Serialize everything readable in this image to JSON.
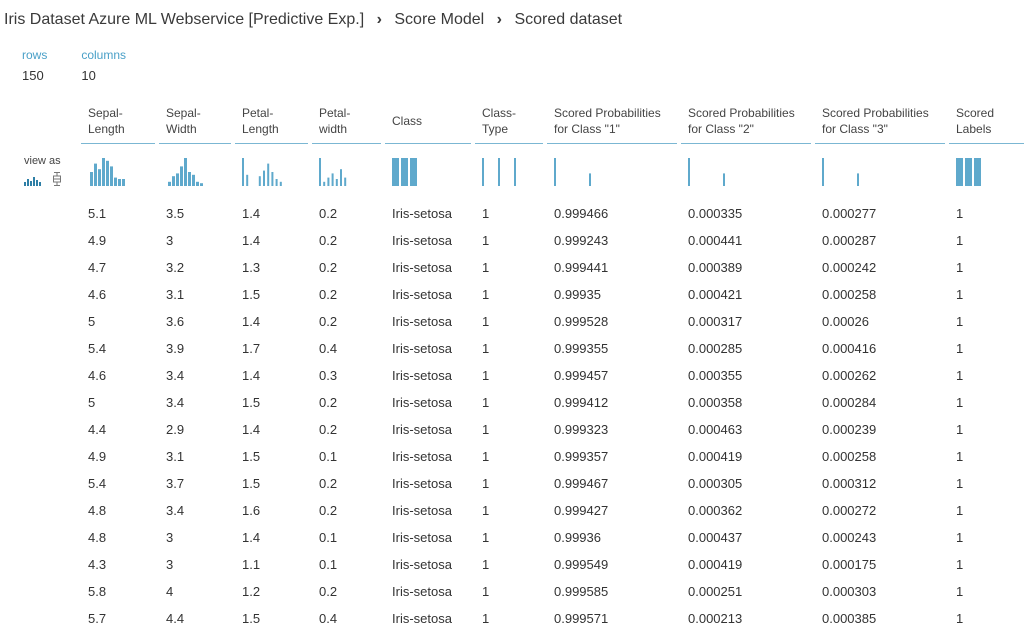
{
  "breadcrumb": {
    "experiment": "Iris Dataset Azure ML Webservice [Predictive Exp.]",
    "module": "Score Model",
    "port": "Scored dataset"
  },
  "stats": {
    "rows_label": "rows",
    "rows_value": "150",
    "columns_label": "columns",
    "columns_value": "10"
  },
  "view_as": {
    "label": "view as",
    "icons": [
      "histogram-icon",
      "boxplot-icon"
    ]
  },
  "columns": [
    "Sepal-\nLength",
    "Sepal-\nWidth",
    "Petal-\nLength",
    "Petal-\nwidth",
    "Class",
    "Class-\nType",
    "Scored Probabilities\nfor Class \"1\"",
    "Scored Probabilities\nfor Class \"2\"",
    "Scored Probabilities\nfor Class \"3\"",
    "Scored\nLabels"
  ],
  "histograms": [
    {
      "type": "dense",
      "bars": [
        0.5,
        0.8,
        0.6,
        1.0,
        0.9,
        0.7,
        0.3,
        0.25,
        0.25
      ]
    },
    {
      "type": "dense",
      "bars": [
        0.15,
        0.35,
        0.45,
        0.7,
        1.0,
        0.5,
        0.4,
        0.15,
        0.1
      ]
    },
    {
      "type": "sparse",
      "bars": [
        1.0,
        0.4,
        0,
        0,
        0.35,
        0.55,
        0.8,
        0.5,
        0.25,
        0.15
      ]
    },
    {
      "type": "sparse",
      "bars": [
        1.0,
        0.15,
        0.3,
        0.45,
        0.25,
        0.6,
        0.3
      ]
    },
    {
      "type": "blocks",
      "bars": [
        1.0,
        1.0,
        1.0
      ]
    },
    {
      "type": "lines",
      "bars": [
        1.0,
        1.0,
        1.0
      ]
    },
    {
      "type": "two",
      "bars": [
        1.0,
        0.45
      ]
    },
    {
      "type": "two",
      "bars": [
        1.0,
        0.45
      ]
    },
    {
      "type": "two",
      "bars": [
        1.0,
        0.45
      ]
    },
    {
      "type": "blocks",
      "bars": [
        1.0,
        1.0,
        1.0
      ]
    }
  ],
  "rows": [
    [
      "5.1",
      "3.5",
      "1.4",
      "0.2",
      "Iris-setosa",
      "1",
      "0.999466",
      "0.000335",
      "0.000277",
      "1"
    ],
    [
      "4.9",
      "3",
      "1.4",
      "0.2",
      "Iris-setosa",
      "1",
      "0.999243",
      "0.000441",
      "0.000287",
      "1"
    ],
    [
      "4.7",
      "3.2",
      "1.3",
      "0.2",
      "Iris-setosa",
      "1",
      "0.999441",
      "0.000389",
      "0.000242",
      "1"
    ],
    [
      "4.6",
      "3.1",
      "1.5",
      "0.2",
      "Iris-setosa",
      "1",
      "0.99935",
      "0.000421",
      "0.000258",
      "1"
    ],
    [
      "5",
      "3.6",
      "1.4",
      "0.2",
      "Iris-setosa",
      "1",
      "0.999528",
      "0.000317",
      "0.00026",
      "1"
    ],
    [
      "5.4",
      "3.9",
      "1.7",
      "0.4",
      "Iris-setosa",
      "1",
      "0.999355",
      "0.000285",
      "0.000416",
      "1"
    ],
    [
      "4.6",
      "3.4",
      "1.4",
      "0.3",
      "Iris-setosa",
      "1",
      "0.999457",
      "0.000355",
      "0.000262",
      "1"
    ],
    [
      "5",
      "3.4",
      "1.5",
      "0.2",
      "Iris-setosa",
      "1",
      "0.999412",
      "0.000358",
      "0.000284",
      "1"
    ],
    [
      "4.4",
      "2.9",
      "1.4",
      "0.2",
      "Iris-setosa",
      "1",
      "0.999323",
      "0.000463",
      "0.000239",
      "1"
    ],
    [
      "4.9",
      "3.1",
      "1.5",
      "0.1",
      "Iris-setosa",
      "1",
      "0.999357",
      "0.000419",
      "0.000258",
      "1"
    ],
    [
      "5.4",
      "3.7",
      "1.5",
      "0.2",
      "Iris-setosa",
      "1",
      "0.999467",
      "0.000305",
      "0.000312",
      "1"
    ],
    [
      "4.8",
      "3.4",
      "1.6",
      "0.2",
      "Iris-setosa",
      "1",
      "0.999427",
      "0.000362",
      "0.000272",
      "1"
    ],
    [
      "4.8",
      "3",
      "1.4",
      "0.1",
      "Iris-setosa",
      "1",
      "0.99936",
      "0.000437",
      "0.000243",
      "1"
    ],
    [
      "4.3",
      "3",
      "1.1",
      "0.1",
      "Iris-setosa",
      "1",
      "0.999549",
      "0.000419",
      "0.000175",
      "1"
    ],
    [
      "5.8",
      "4",
      "1.2",
      "0.2",
      "Iris-setosa",
      "1",
      "0.999585",
      "0.000251",
      "0.000303",
      "1"
    ],
    [
      "5.7",
      "4.4",
      "1.5",
      "0.4",
      "Iris-setosa",
      "1",
      "0.999571",
      "0.000213",
      "0.000385",
      "1"
    ]
  ],
  "colors": {
    "accent": "#4aa0c8",
    "bar": "#5fa9cc",
    "border": "#7bb7d3"
  }
}
